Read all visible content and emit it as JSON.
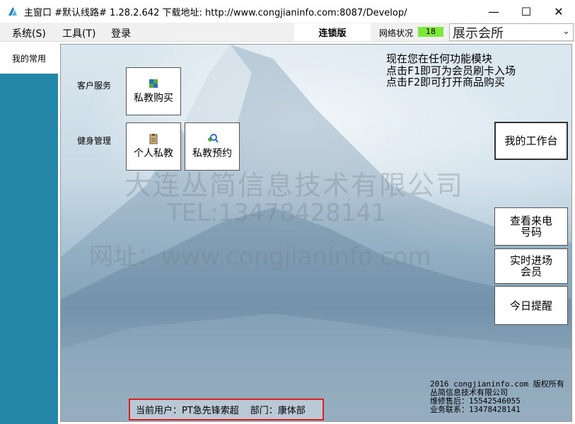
{
  "window": {
    "title": "主窗口 #默认线路# 1.28.2.642 下载地址: http://www.congjianinfo.com:8087/Develop/",
    "minimize": "—",
    "maximize": "☐",
    "close": "✕"
  },
  "menu": {
    "system": "系统(S)",
    "tools": "工具(T)",
    "login": "登录"
  },
  "toolbar": {
    "edition": "连锁版",
    "network_label": "网络状况",
    "network_value": "18",
    "venue": "展示会所",
    "venue_arrow": "⌄"
  },
  "sidebar": {
    "tab_favorites": "我的常用"
  },
  "main": {
    "watermark": {
      "company": "大连丛简信息技术有限公司",
      "tel": "TEL:13478428141",
      "site": "网址：www.congjianinfo.com"
    },
    "sections": {
      "customer_service": "客户服务",
      "fitness_management": "健身管理"
    },
    "buttons": {
      "pt_purchase": "私教购买",
      "personal_trainer": "个人私教",
      "pt_booking": "私教预约",
      "my_workbench": "我的工作台",
      "caller_id_line1": "查看来电",
      "caller_id_line2": "号码",
      "live_entry_line1": "实时进场",
      "live_entry_line2": "会员",
      "today_reminder": "今日提醒"
    },
    "hints": {
      "line1": "现在您在任何功能模块",
      "line2": "点击F1即可为会员刷卡入场",
      "line3": "点击F2即可打开商品购买"
    },
    "copyright": {
      "line1": "2016 congjianinfo.com 版权所有",
      "line2": "丛简信息技术有限公司",
      "line3": "维修售后：15542546055",
      "line4": "业务联系：13478428141"
    },
    "status": {
      "current_user": "当前用户：PT急先锋索超",
      "department": "部门：康体部"
    }
  },
  "colors": {
    "sidebar": "#2386a8",
    "network_ok": "#7ee83a",
    "highlight_border": "#e02020"
  }
}
